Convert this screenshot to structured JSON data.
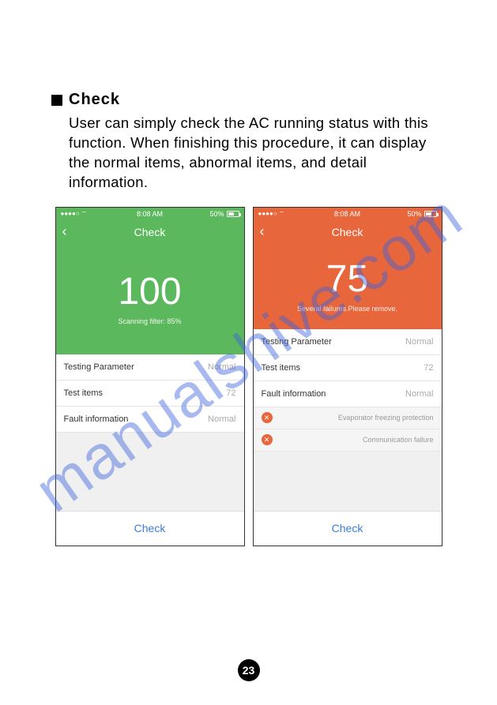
{
  "watermark": "manualshive.com",
  "heading": "Check",
  "description": "User can simply check the AC running status with this function. When finishing this procedure, it can display the normal items, abnormal items, and detail information.",
  "status": {
    "signal": "●●●●○",
    "wifi": "⌔",
    "time": "8:08 AM",
    "battery_pct": "50%"
  },
  "nav_title": "Check",
  "phone_left": {
    "hero_num": "100",
    "hero_sub": "Scanning filter: 85%",
    "rows": [
      {
        "label": "Testing Parameter",
        "value": "Normal"
      },
      {
        "label": "Test items",
        "value": "72"
      },
      {
        "label": "Fault information",
        "value": "Normal"
      }
    ]
  },
  "phone_right": {
    "hero_num": "75",
    "hero_sub": "Several failures.Please remove.",
    "rows": [
      {
        "label": "Testing Parameter",
        "value": "Normal"
      },
      {
        "label": "Test items",
        "value": "72"
      },
      {
        "label": "Fault information",
        "value": "Normal"
      }
    ],
    "faults": [
      "Evaporator freezing protection",
      "Communication failure"
    ]
  },
  "check_button": "Check",
  "page_number": "23"
}
